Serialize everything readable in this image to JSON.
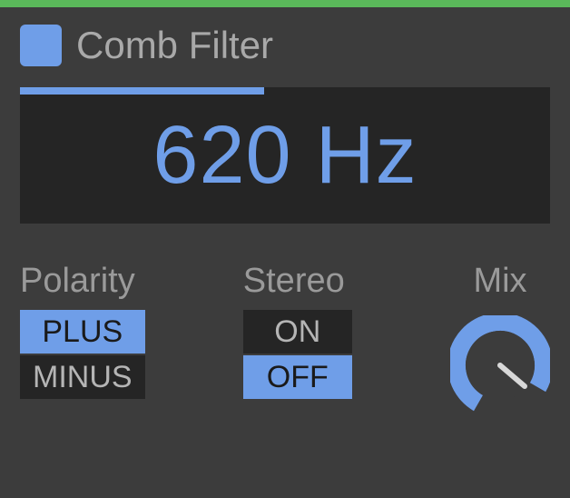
{
  "title": "Comb Filter",
  "frequency": {
    "display": "620 Hz",
    "fill_percent": 46
  },
  "polarity": {
    "label": "Polarity",
    "options": [
      "PLUS",
      "MINUS"
    ],
    "selected": "PLUS"
  },
  "stereo": {
    "label": "Stereo",
    "options": [
      "ON",
      "OFF"
    ],
    "selected": "OFF"
  },
  "mix": {
    "label": "Mix",
    "angle_deg": 135
  },
  "colors": {
    "accent": "#6f9ee8",
    "bg_dark": "#252525",
    "panel": "#3c3c3c",
    "top_bar": "#5ab85a"
  }
}
